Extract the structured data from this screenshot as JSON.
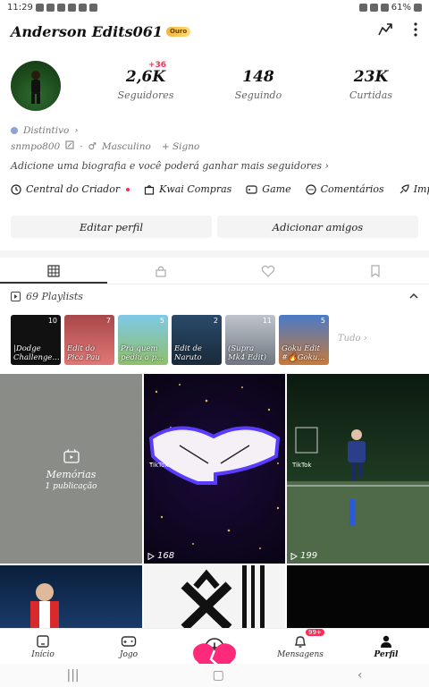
{
  "status_bar": {
    "time": "11:29",
    "battery": "61%"
  },
  "profile": {
    "username": "Anderson Edits061",
    "badge": "Ouro",
    "stats": [
      {
        "value": "2,6K",
        "label": "Seguidores",
        "delta": "+36"
      },
      {
        "value": "148",
        "label": "Seguindo"
      },
      {
        "value": "23K",
        "label": "Curtidas"
      }
    ],
    "distinctive": "Distintivo",
    "handle": "snmpo800",
    "gender": "Masculino",
    "sign": "+ Signo",
    "bio_prompt": "Adicione uma biografia e você poderá ganhar mais seguidores"
  },
  "shortcuts": [
    "Central do Criador",
    "Kwai Compras",
    "Game",
    "Comentários",
    "Impulsi"
  ],
  "buttons": {
    "edit": "Editar perfil",
    "add_friends": "Adicionar amigos"
  },
  "playlists": {
    "header": "69 Playlists",
    "more": "Tudo",
    "items": [
      {
        "title": "|Dodge Challenge...",
        "count": "10"
      },
      {
        "title": "Edit do Pica Pau",
        "count": "7"
      },
      {
        "title": "Pra quem pediu a p...",
        "count": "5"
      },
      {
        "title": "Edit de Naruto",
        "count": "2"
      },
      {
        "title": "(Supra Mk4 Edit)",
        "count": "11"
      },
      {
        "title": "Goku Edit #🔥Goku...",
        "count": "5"
      }
    ]
  },
  "grid": {
    "memories_title": "Memórias",
    "memories_sub": "1 publicação",
    "views": [
      "168",
      "199"
    ],
    "tiktok_label": "TikTok"
  },
  "bottom_nav": [
    {
      "label": "Início"
    },
    {
      "label": "Jogo"
    },
    {
      "label": ""
    },
    {
      "label": "Mensagens",
      "badge": "99+"
    },
    {
      "label": "Perfil"
    }
  ],
  "colors": {
    "accent": "#ff2a55",
    "gold": "#f0b83a",
    "heart": "#ff2a7a"
  }
}
